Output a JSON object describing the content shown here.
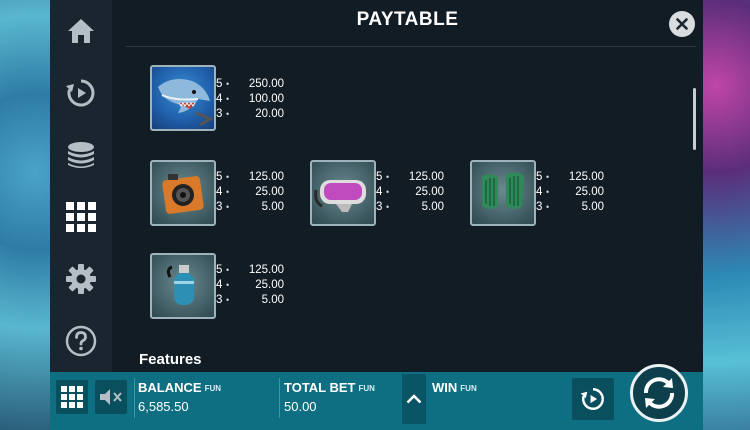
{
  "title": "PAYTABLE",
  "sidebar": {
    "items": [
      {
        "name": "home",
        "icon": "home-icon"
      },
      {
        "name": "autoplay",
        "icon": "replay-icon"
      },
      {
        "name": "bet",
        "icon": "coin-stack-icon"
      },
      {
        "name": "paytable",
        "icon": "grid-icon",
        "active": true
      },
      {
        "name": "settings",
        "icon": "gear-icon"
      },
      {
        "name": "help",
        "icon": "help-icon"
      }
    ]
  },
  "symbols": [
    {
      "name": "shark",
      "pays": [
        {
          "count": "5",
          "amount": "250.00"
        },
        {
          "count": "4",
          "amount": "100.00"
        },
        {
          "count": "3",
          "amount": "20.00"
        }
      ]
    },
    {
      "name": "camera",
      "pays": [
        {
          "count": "5",
          "amount": "125.00"
        },
        {
          "count": "4",
          "amount": "25.00"
        },
        {
          "count": "3",
          "amount": "5.00"
        }
      ]
    },
    {
      "name": "mask",
      "pays": [
        {
          "count": "5",
          "amount": "125.00"
        },
        {
          "count": "4",
          "amount": "25.00"
        },
        {
          "count": "3",
          "amount": "5.00"
        }
      ]
    },
    {
      "name": "fins",
      "pays": [
        {
          "count": "5",
          "amount": "125.00"
        },
        {
          "count": "4",
          "amount": "25.00"
        },
        {
          "count": "3",
          "amount": "5.00"
        }
      ]
    },
    {
      "name": "tank",
      "pays": [
        {
          "count": "5",
          "amount": "125.00"
        },
        {
          "count": "4",
          "amount": "25.00"
        },
        {
          "count": "3",
          "amount": "5.00"
        }
      ]
    }
  ],
  "features_heading": "Features",
  "bottom": {
    "balance_label": "BALANCE",
    "balance_fun": "FUN",
    "balance_value": "6,585.50",
    "total_bet_label": "TOTAL BET",
    "total_bet_fun": "FUN",
    "total_bet_value": "50.00",
    "win_label": "WIN",
    "win_fun": "FUN",
    "win_value": ""
  },
  "colors": {
    "panel": "#121c24",
    "sidebar": "#1a2530",
    "bottom_bar": "#0f6f82",
    "icon": "#c8d0d5"
  }
}
